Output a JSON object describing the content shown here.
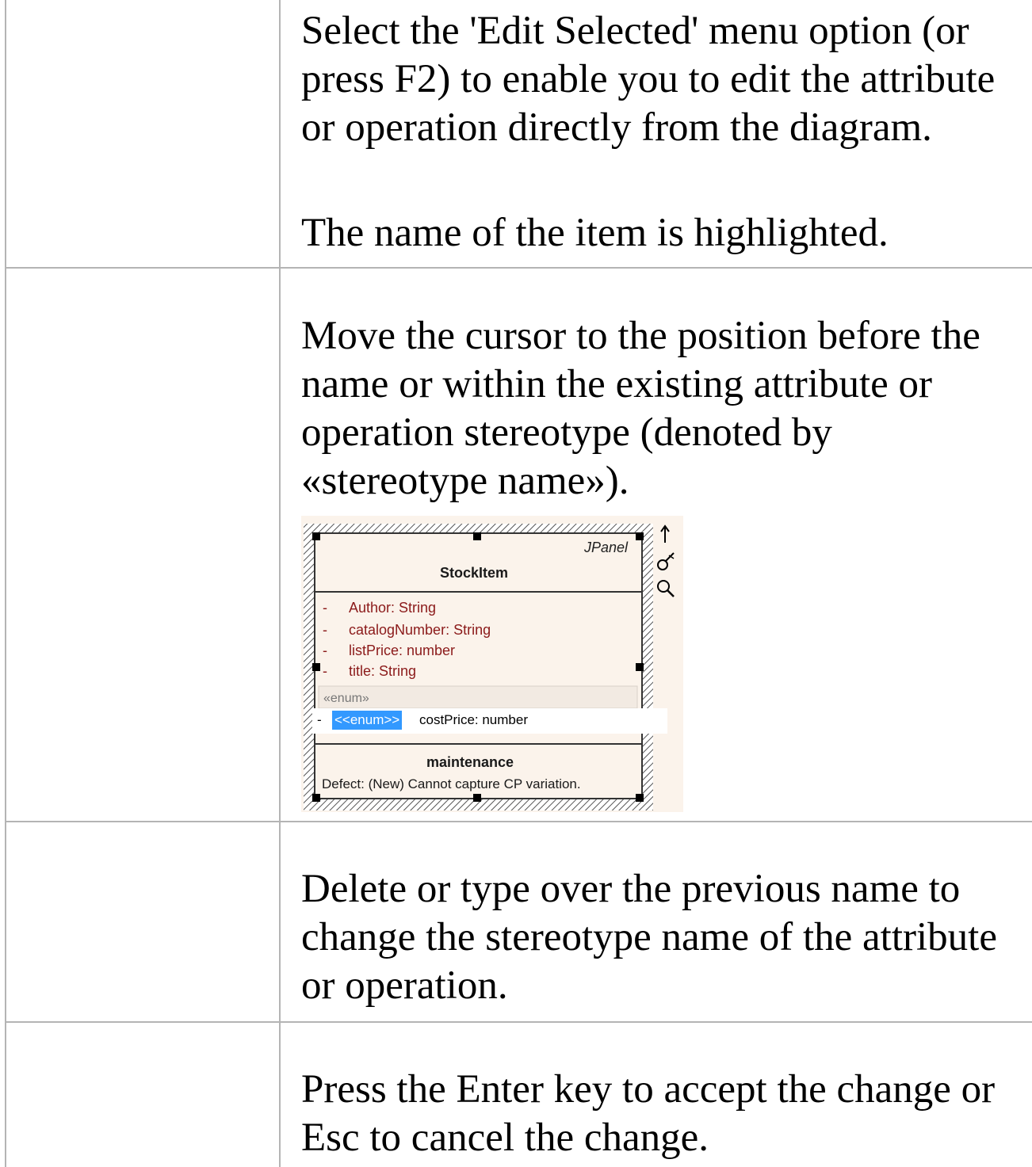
{
  "steps": [
    {
      "text": "Select the 'Edit Selected' menu option (or press F2) to enable you to edit the attribute or operation directly from the diagram.",
      "note": "The name of the item is highlighted."
    },
    {
      "text": "Move the cursor to the position before the name or within the existing attribute or operation stereotype (denoted by «stereotype name»)."
    },
    {
      "text": "Delete or type over the previous name to change the stereotype name of the attribute or operation."
    },
    {
      "text": "Press the Enter key to accept the change or Esc to cancel the change."
    }
  ],
  "diagram": {
    "element_stereotype": "JPanel",
    "class_name": "StockItem",
    "attributes": [
      {
        "visibility": "-",
        "text": "Author:  String"
      },
      {
        "visibility": "-",
        "text": "catalogNumber:  String"
      },
      {
        "visibility": "-",
        "text": "listPrice:  number"
      },
      {
        "visibility": "-",
        "text": "title:  String"
      }
    ],
    "enum_group_label": "«enum»",
    "edit_visibility": "-",
    "edit_selected_text": "<<enum>>",
    "edit_remaining_text": "costPrice: number",
    "maintenance_title": "maintenance",
    "maintenance_item": "Defect: (New) Cannot capture CP variation.",
    "icons": [
      "arrow-up-icon",
      "brush-icon",
      "magnifier-icon"
    ],
    "colors": {
      "background": "#fbf3eb",
      "attribute_text": "#8b1a1a",
      "selection": "#3399ff"
    }
  }
}
